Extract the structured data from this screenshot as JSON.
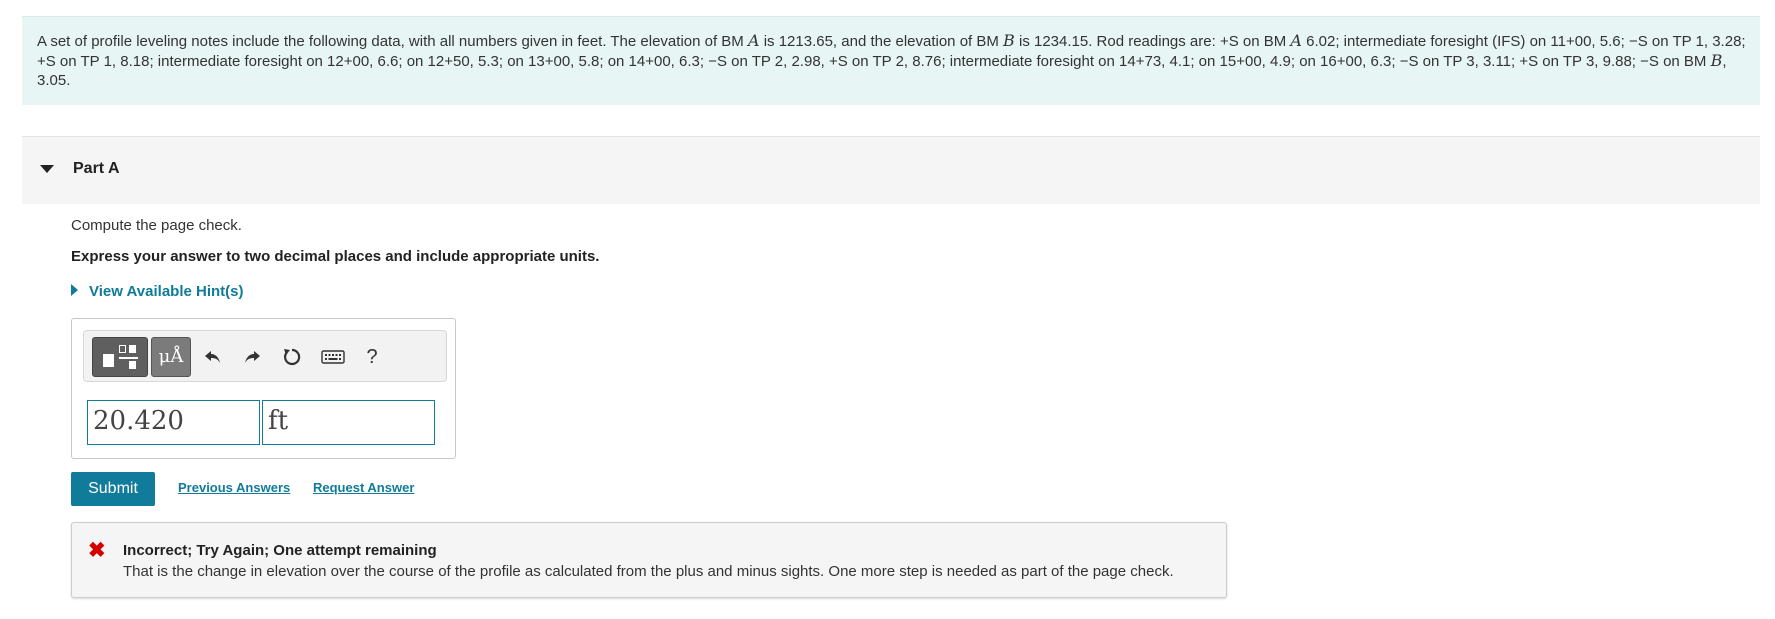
{
  "problem": {
    "segments": [
      "A set of profile leveling notes include the following data, with all numbers given in feet. The elevation of BM ",
      "A",
      " is 1213.65, and the elevation of BM ",
      "B",
      " is 1234.15. Rod readings are: +S on BM ",
      "A",
      " 6.02; intermediate foresight (IFS) on 11+00, 5.6; −S on TP 1, 3.28; +S on TP 1, 8.18; intermediate foresight on 12+00, 6.6; on 12+50, 5.3; on 13+00, 5.8; on 14+00, 6.3; −S on TP 2, 2.98, +S on TP 2, 8.76; intermediate foresight on 14+73, 4.1; on 15+00, 4.9; on 16+00, 6.3; −S on TP 3, 3.11; +S on TP 3, 9.88; −S on BM ",
      "B",
      ", 3.05."
    ]
  },
  "part": {
    "label": "Part A",
    "instruction": "Compute the page check.",
    "instruction_bold": "Express your answer to two decimal places and include appropriate units.",
    "hint_link": "View Available Hint(s)"
  },
  "answer": {
    "value": "20.420",
    "units": "ft",
    "toolbar": {
      "units_label": "μÅ",
      "help_label": "?"
    }
  },
  "actions": {
    "submit": "Submit",
    "previous_answers": "Previous Answers",
    "request_answer": "Request Answer"
  },
  "feedback": {
    "icon": "✖",
    "title": "Incorrect; Try Again; One attempt remaining",
    "message": "That is the change in elevation over the course of the profile as calculated from the plus and minus sights. One more step is needed as part of the page check."
  },
  "colors": {
    "accent": "#107b9a",
    "problem_bg": "#e7f5f5",
    "error": "#d40000"
  }
}
